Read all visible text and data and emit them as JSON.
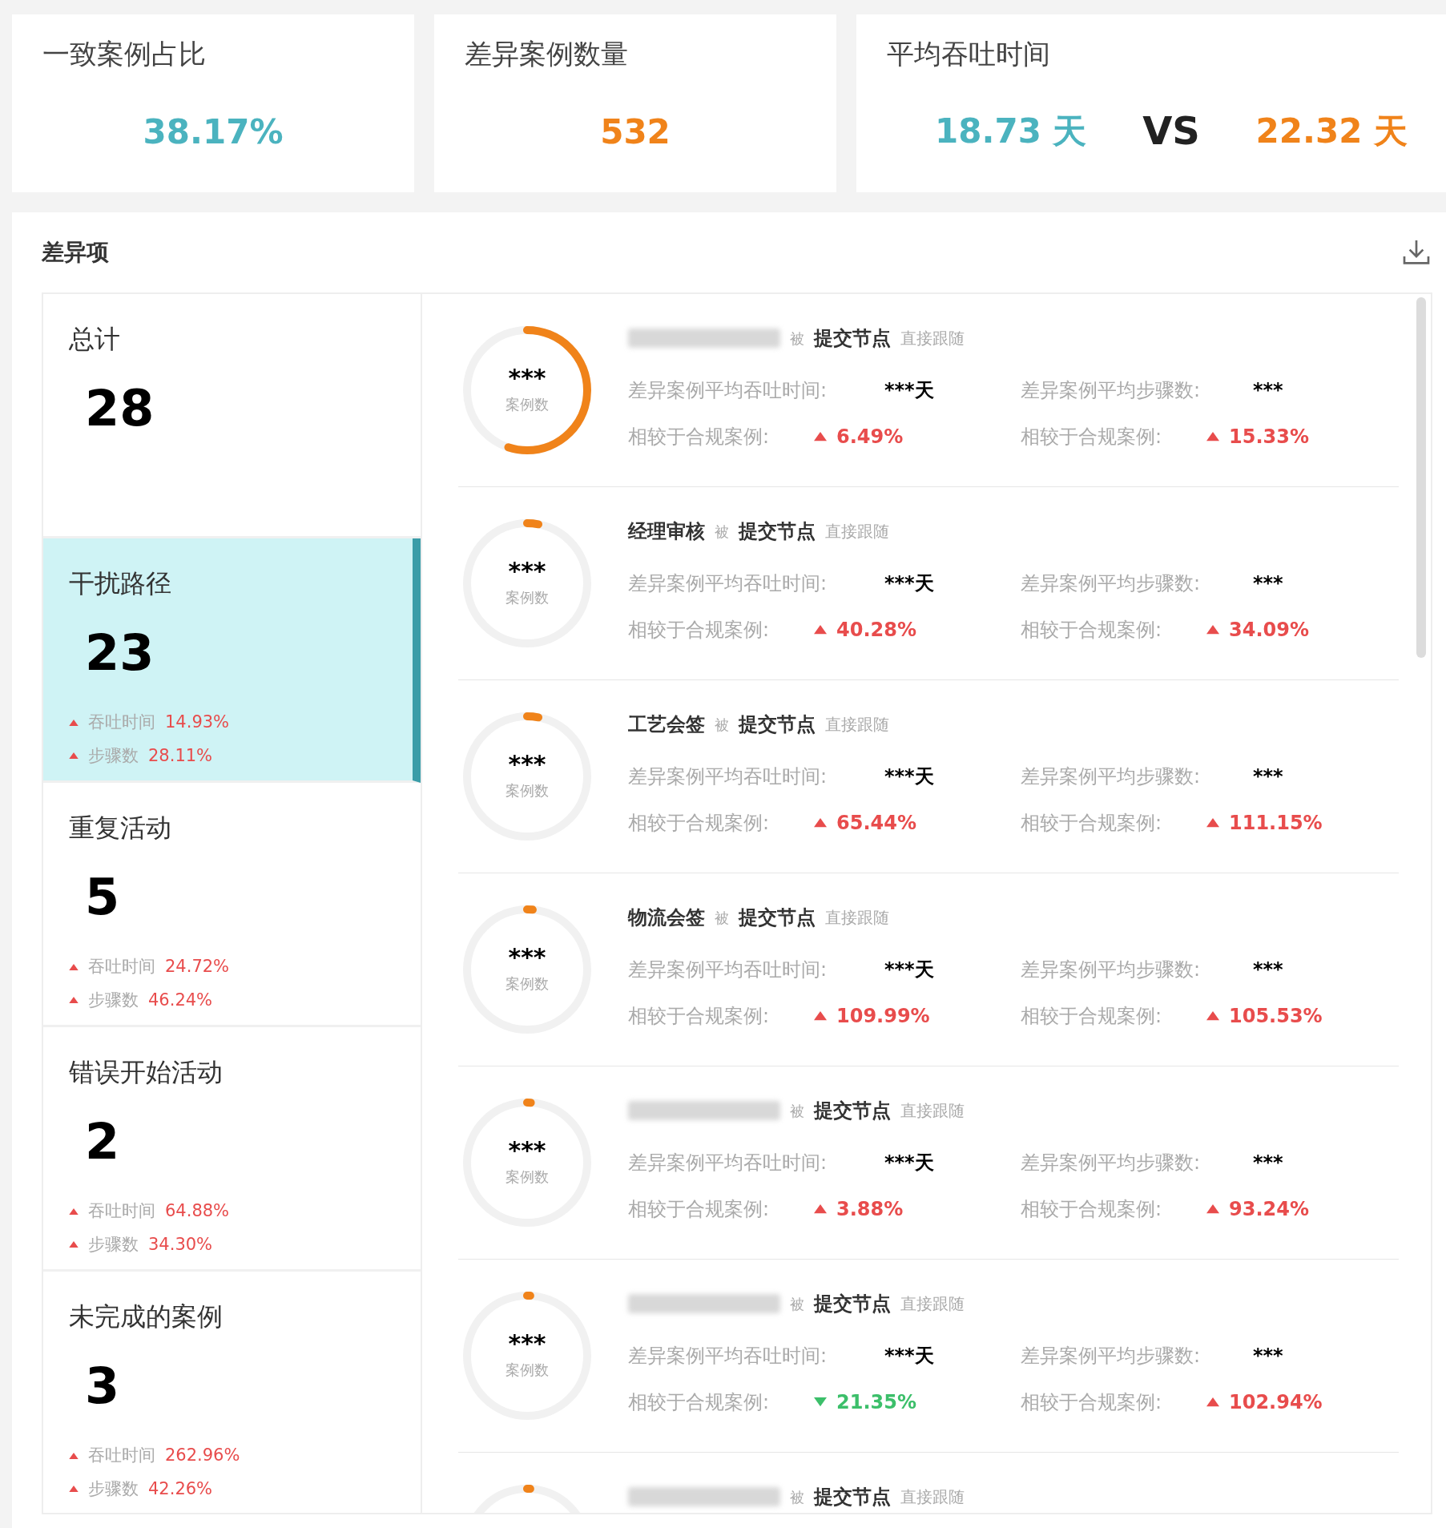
{
  "summary_cards": [
    {
      "title": "一致案例占比",
      "kind": "single",
      "value": {
        "text": "38.17%",
        "color": "#4bb3bf"
      }
    },
    {
      "title": "差异案例数量",
      "kind": "single",
      "value": {
        "text": "532",
        "color": "#f0831a"
      }
    },
    {
      "title": "平均吞吐时间",
      "kind": "compare",
      "left": {
        "text": "18.73",
        "unit": "天",
        "color": "#4bb3bf"
      },
      "separator": "VS",
      "right": {
        "text": "22.32",
        "unit": "天",
        "color": "#f0831a"
      }
    }
  ],
  "panel": {
    "title": "差异项",
    "categories": [
      {
        "label": "总计",
        "count": "28",
        "selected": false
      },
      {
        "label": "干扰路径",
        "count": "23",
        "selected": true,
        "metrics": [
          {
            "label": "吞吐时间",
            "value": "14.93%",
            "up": true
          },
          {
            "label": "步骤数",
            "value": "28.11%",
            "up": true
          }
        ]
      },
      {
        "label": "重复活动",
        "count": "5",
        "selected": false,
        "metrics": [
          {
            "label": "吞吐时间",
            "value": "24.72%",
            "up": true
          },
          {
            "label": "步骤数",
            "value": "46.24%",
            "up": true
          }
        ]
      },
      {
        "label": "错误开始活动",
        "count": "2",
        "selected": false,
        "metrics": [
          {
            "label": "吞吐时间",
            "value": "64.88%",
            "up": true
          },
          {
            "label": "步骤数",
            "value": "34.30%",
            "up": true
          }
        ]
      },
      {
        "label": "未完成的案例",
        "count": "3",
        "selected": false,
        "metrics": [
          {
            "label": "吞吐时间",
            "value": "262.96%",
            "up": true
          },
          {
            "label": "步骤数",
            "value": "42.26%",
            "up": true
          }
        ]
      }
    ],
    "items": [
      {
        "level": 0.55,
        "count": "***",
        "count_label": "案例数",
        "source": {
          "kind": "redacted"
        },
        "by": "被",
        "target": "提交节点",
        "relation": "直接跟随",
        "stats": {
          "time_label": "差异案例平均吞吐时间:",
          "time_value": "***天",
          "time_compare_label": "相较于合规案例:",
          "time_change": "6.49%",
          "time_up": true,
          "steps_label": "差异案例平均步骤数:",
          "steps_value": "***",
          "steps_compare_label": "相较于合规案例:",
          "steps_change": "15.33%",
          "steps_up": true
        }
      },
      {
        "level": 0.03,
        "count": "***",
        "count_label": "案例数",
        "source": {
          "kind": "text",
          "text": "经理审核"
        },
        "by": "被",
        "target": "提交节点",
        "relation": "直接跟随",
        "stats": {
          "time_label": "差异案例平均吞吐时间:",
          "time_value": "***天",
          "time_compare_label": "相较于合规案例:",
          "time_change": "40.28%",
          "time_up": true,
          "steps_label": "差异案例平均步骤数:",
          "steps_value": "***",
          "steps_compare_label": "相较于合规案例:",
          "steps_change": "34.09%",
          "steps_up": true
        }
      },
      {
        "level": 0.03,
        "count": "***",
        "count_label": "案例数",
        "source": {
          "kind": "text",
          "text": "工艺会签"
        },
        "by": "被",
        "target": "提交节点",
        "relation": "直接跟随",
        "stats": {
          "time_label": "差异案例平均吞吐时间:",
          "time_value": "***天",
          "time_compare_label": "相较于合规案例:",
          "time_change": "65.44%",
          "time_up": true,
          "steps_label": "差异案例平均步骤数:",
          "steps_value": "***",
          "steps_compare_label": "相较于合规案例:",
          "steps_change": "111.15%",
          "steps_up": true
        }
      },
      {
        "level": 0.015,
        "count": "***",
        "count_label": "案例数",
        "source": {
          "kind": "text",
          "text": "物流会签"
        },
        "by": "被",
        "target": "提交节点",
        "relation": "直接跟随",
        "stats": {
          "time_label": "差异案例平均吞吐时间:",
          "time_value": "***天",
          "time_compare_label": "相较于合规案例:",
          "time_change": "109.99%",
          "time_up": true,
          "steps_label": "差异案例平均步骤数:",
          "steps_value": "***",
          "steps_compare_label": "相较于合规案例:",
          "steps_change": "105.53%",
          "steps_up": true
        }
      },
      {
        "level": 0.01,
        "count": "***",
        "count_label": "案例数",
        "source": {
          "kind": "redacted"
        },
        "by": "被",
        "target": "提交节点",
        "relation": "直接跟随",
        "stats": {
          "time_label": "差异案例平均吞吐时间:",
          "time_value": "***天",
          "time_compare_label": "相较于合规案例:",
          "time_change": "3.88%",
          "time_up": true,
          "steps_label": "差异案例平均步骤数:",
          "steps_value": "***",
          "steps_compare_label": "相较于合规案例:",
          "steps_change": "93.24%",
          "steps_up": true
        }
      },
      {
        "level": 0.008,
        "count": "***",
        "count_label": "案例数",
        "source": {
          "kind": "redacted"
        },
        "by": "被",
        "target": "提交节点",
        "relation": "直接跟随",
        "stats": {
          "time_label": "差异案例平均吞吐时间:",
          "time_value": "***天",
          "time_compare_label": "相较于合规案例:",
          "time_change": "21.35%",
          "time_up": false,
          "steps_label": "差异案例平均步骤数:",
          "steps_value": "***",
          "steps_compare_label": "相较于合规案例:",
          "steps_change": "102.94%",
          "steps_up": true
        }
      },
      {
        "level": 0.008,
        "source": {
          "kind": "redacted"
        },
        "by": "被",
        "target": "提交节点",
        "relation": "直接跟随"
      }
    ]
  }
}
